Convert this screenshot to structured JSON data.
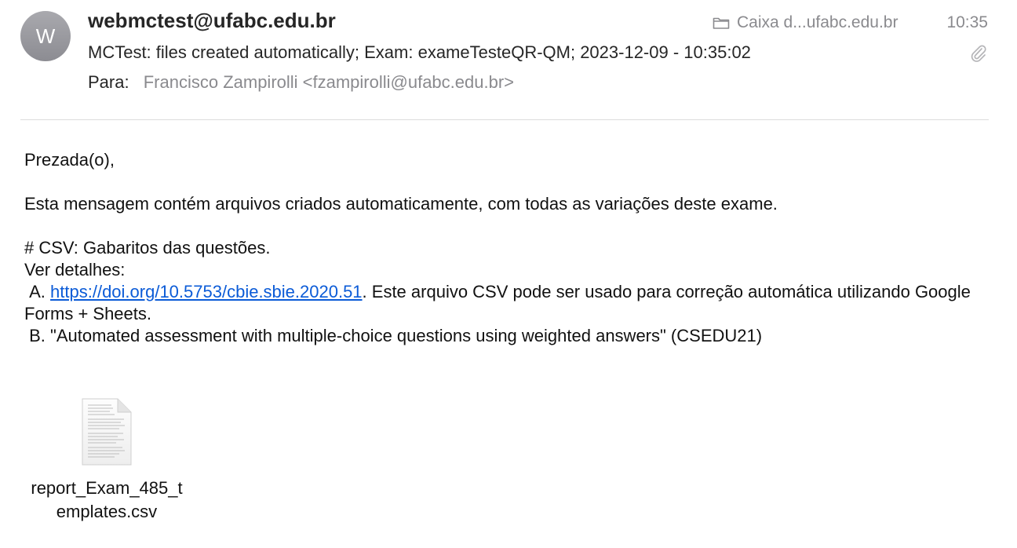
{
  "header": {
    "avatar_initial": "W",
    "from": "webmctest@ufabc.edu.br",
    "subject": "MCTest: files created automatically; Exam: exameTesteQR-QM; 2023-12-09 - 10:35:02",
    "to_label": "Para:",
    "to_value": "Francisco Zampirolli <fzampirolli@ufabc.edu.br>",
    "mailbox": "Caixa d...ufabc.edu.br",
    "time": "10:35",
    "mailbox_icon": "folder-icon",
    "attachment_icon": "paperclip-icon"
  },
  "body": {
    "greeting": "Prezada(o),",
    "intro": "Esta mensagem contém arquivos criados automaticamente, com todas as variações deste exame.",
    "csv_heading": "# CSV:  Gabaritos das questões.",
    "details_label": "Ver detalhes:",
    "item_a_prefix": " A. ",
    "item_a_link": "https://doi.org/10.5753/cbie.sbie.2020.51",
    "item_a_rest": ". Este arquivo CSV pode ser usado para correção automática utilizando Google Forms + Sheets.",
    "item_b": " B. \"Automated assessment with multiple-choice questions using weighted answers\" (CSEDU21)"
  },
  "attachment": {
    "filename": "report_Exam_485_templates.csv",
    "icon": "document-icon"
  },
  "colors": {
    "link": "#0b5bd7",
    "muted": "#8a8a8e",
    "avatar": "#9a9aa0"
  }
}
